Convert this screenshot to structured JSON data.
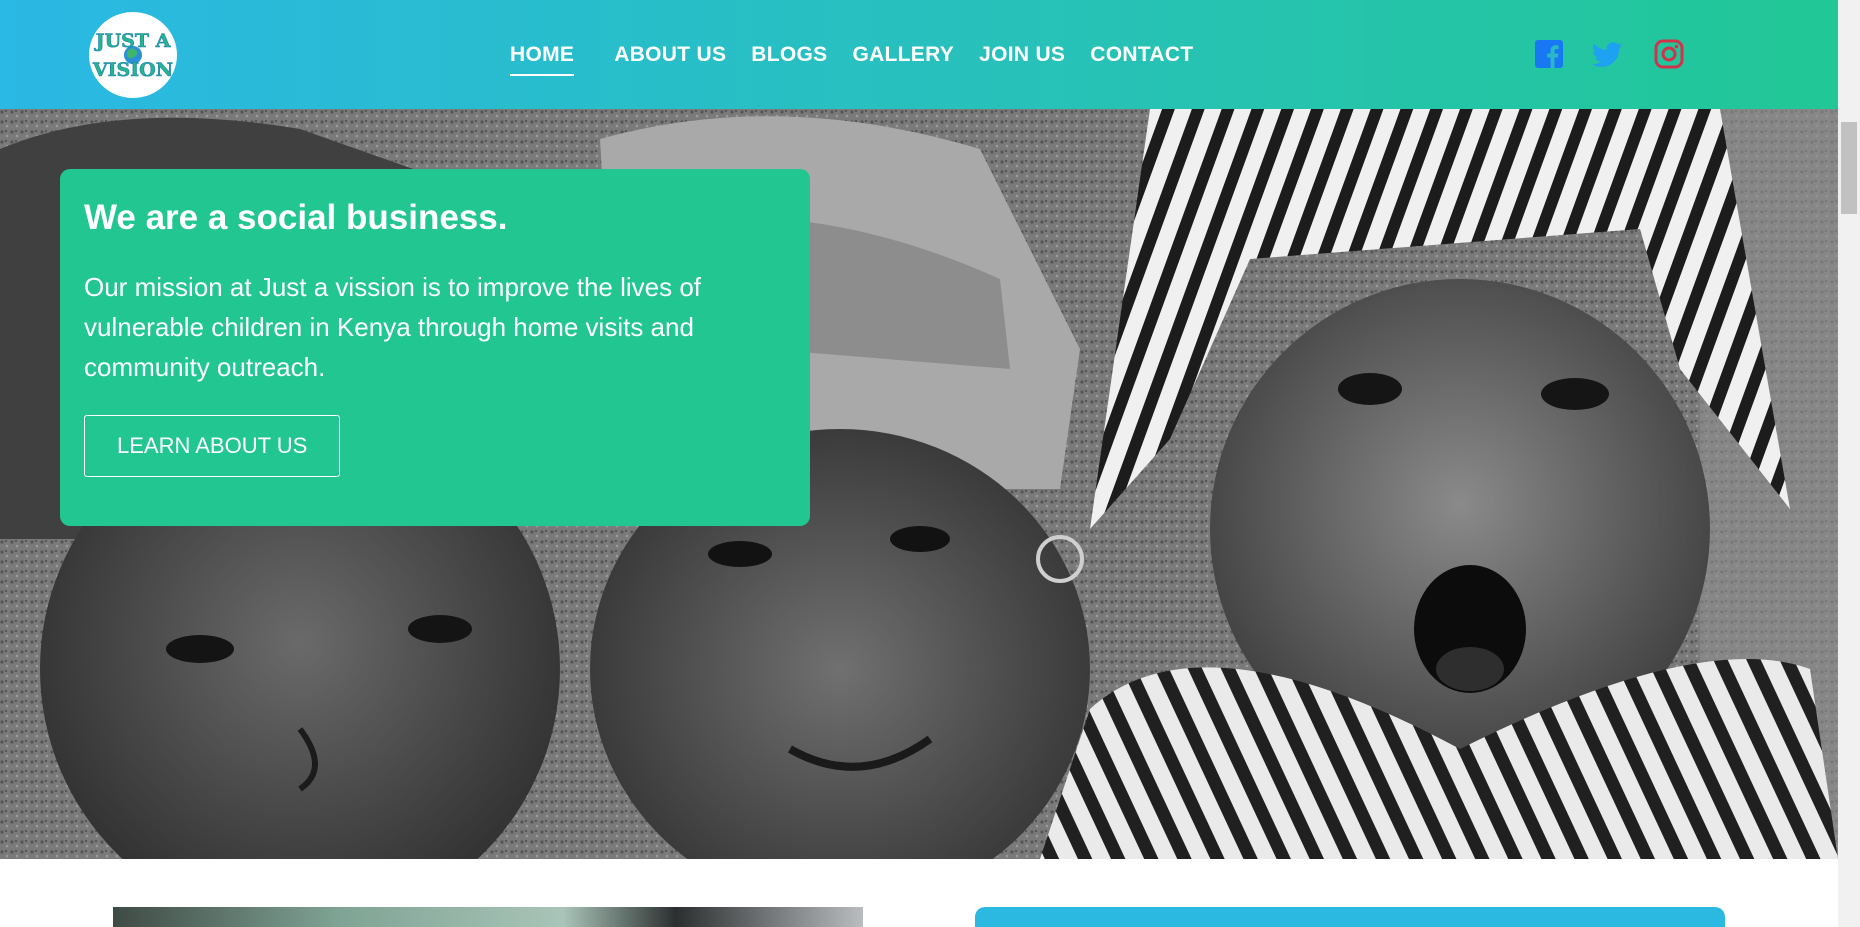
{
  "logo": {
    "line1": "JUST A",
    "line2": "VISION"
  },
  "nav": {
    "items": [
      {
        "label": "HOME",
        "active": true
      },
      {
        "label": "ABOUT US",
        "active": false
      },
      {
        "label": "BLOGS",
        "active": false
      },
      {
        "label": "GALLERY",
        "active": false
      },
      {
        "label": "JOIN US",
        "active": false
      },
      {
        "label": "CONTACT",
        "active": false
      }
    ]
  },
  "social": [
    {
      "icon": "facebook-icon",
      "color": "#1877f2"
    },
    {
      "icon": "twitter-icon",
      "color": "#1da1f2"
    },
    {
      "icon": "instagram-icon",
      "color": "#e4405f"
    }
  ],
  "hero": {
    "title": "We are a social business.",
    "text": "Our mission at Just a vission is to improve the lives of vulnerable children in Kenya through home visits and community outreach.",
    "button": "LEARN ABOUT US"
  },
  "colors": {
    "header_start": "#2ab8e4",
    "header_end": "#21c796",
    "card": "#21c690",
    "side_card": "#2bb9e2"
  }
}
